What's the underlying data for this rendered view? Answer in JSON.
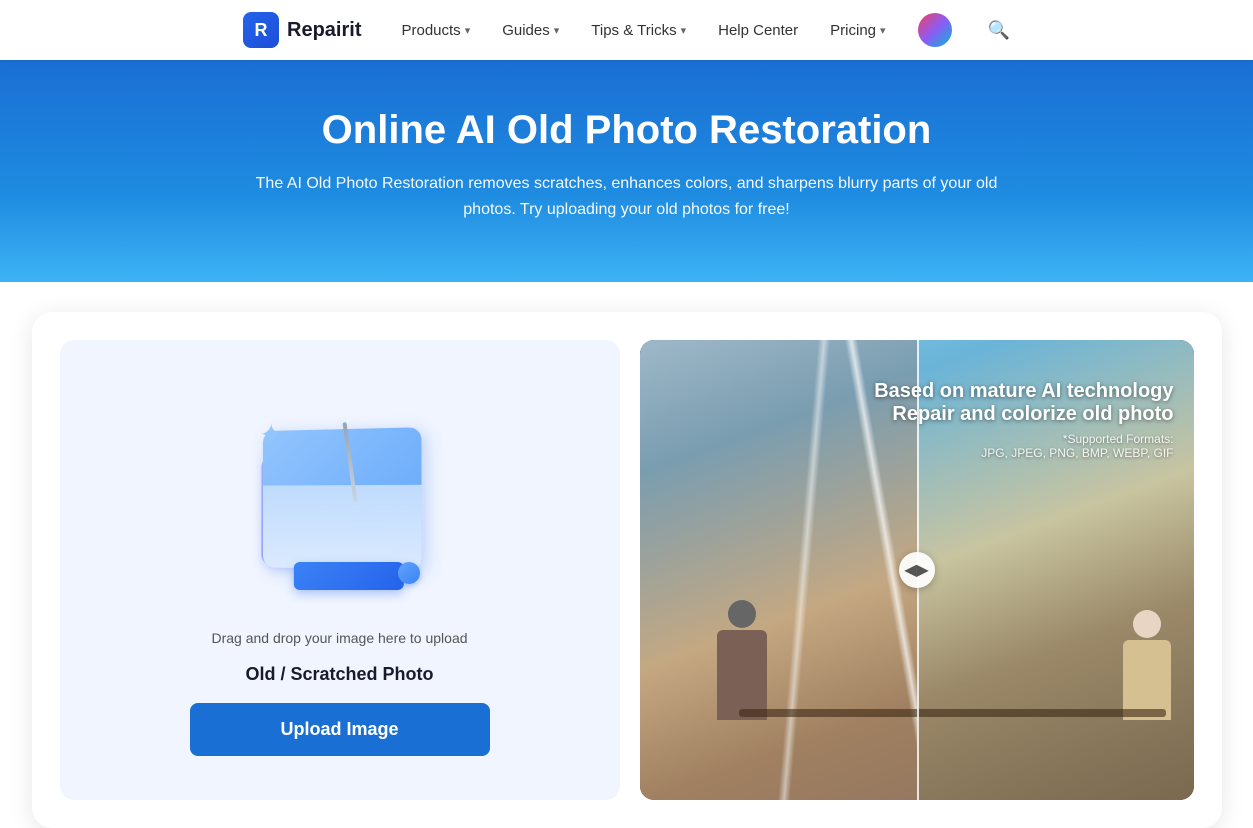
{
  "brand": {
    "logo_letter": "R",
    "name": "Repairit"
  },
  "nav": {
    "items": [
      {
        "label": "Products",
        "has_dropdown": true
      },
      {
        "label": "Guides",
        "has_dropdown": true
      },
      {
        "label": "Tips & Tricks",
        "has_dropdown": true
      },
      {
        "label": "Help Center",
        "has_dropdown": false
      },
      {
        "label": "Pricing",
        "has_dropdown": true
      }
    ]
  },
  "hero": {
    "title": "Online AI Old Photo Restoration",
    "subtitle": "The AI Old Photo Restoration removes scratches, enhances colors, and sharpens blurry parts of your old photos. Try uploading your old photos for free!"
  },
  "upload": {
    "drag_text": "Drag and drop your image here to upload",
    "photo_type": "Old / Scratched Photo",
    "button_label": "Upload Image"
  },
  "preview": {
    "main_line1": "Based on mature AI technology",
    "main_line2": "Repair and colorize old photo",
    "formats_label": "*Supported Formats:",
    "formats_list": "JPG, JPEG, PNG, BMP, WEBP, GIF"
  }
}
